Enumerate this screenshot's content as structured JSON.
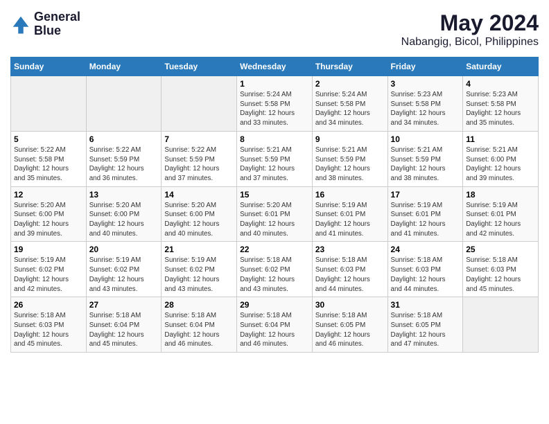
{
  "logo": {
    "line1": "General",
    "line2": "Blue"
  },
  "header": {
    "month": "May 2024",
    "location": "Nabangig, Bicol, Philippines"
  },
  "weekdays": [
    "Sunday",
    "Monday",
    "Tuesday",
    "Wednesday",
    "Thursday",
    "Friday",
    "Saturday"
  ],
  "weeks": [
    [
      {
        "day": "",
        "info": ""
      },
      {
        "day": "",
        "info": ""
      },
      {
        "day": "",
        "info": ""
      },
      {
        "day": "1",
        "info": "Sunrise: 5:24 AM\nSunset: 5:58 PM\nDaylight: 12 hours\nand 33 minutes."
      },
      {
        "day": "2",
        "info": "Sunrise: 5:24 AM\nSunset: 5:58 PM\nDaylight: 12 hours\nand 34 minutes."
      },
      {
        "day": "3",
        "info": "Sunrise: 5:23 AM\nSunset: 5:58 PM\nDaylight: 12 hours\nand 34 minutes."
      },
      {
        "day": "4",
        "info": "Sunrise: 5:23 AM\nSunset: 5:58 PM\nDaylight: 12 hours\nand 35 minutes."
      }
    ],
    [
      {
        "day": "5",
        "info": "Sunrise: 5:22 AM\nSunset: 5:58 PM\nDaylight: 12 hours\nand 35 minutes."
      },
      {
        "day": "6",
        "info": "Sunrise: 5:22 AM\nSunset: 5:59 PM\nDaylight: 12 hours\nand 36 minutes."
      },
      {
        "day": "7",
        "info": "Sunrise: 5:22 AM\nSunset: 5:59 PM\nDaylight: 12 hours\nand 37 minutes."
      },
      {
        "day": "8",
        "info": "Sunrise: 5:21 AM\nSunset: 5:59 PM\nDaylight: 12 hours\nand 37 minutes."
      },
      {
        "day": "9",
        "info": "Sunrise: 5:21 AM\nSunset: 5:59 PM\nDaylight: 12 hours\nand 38 minutes."
      },
      {
        "day": "10",
        "info": "Sunrise: 5:21 AM\nSunset: 5:59 PM\nDaylight: 12 hours\nand 38 minutes."
      },
      {
        "day": "11",
        "info": "Sunrise: 5:21 AM\nSunset: 6:00 PM\nDaylight: 12 hours\nand 39 minutes."
      }
    ],
    [
      {
        "day": "12",
        "info": "Sunrise: 5:20 AM\nSunset: 6:00 PM\nDaylight: 12 hours\nand 39 minutes."
      },
      {
        "day": "13",
        "info": "Sunrise: 5:20 AM\nSunset: 6:00 PM\nDaylight: 12 hours\nand 40 minutes."
      },
      {
        "day": "14",
        "info": "Sunrise: 5:20 AM\nSunset: 6:00 PM\nDaylight: 12 hours\nand 40 minutes."
      },
      {
        "day": "15",
        "info": "Sunrise: 5:20 AM\nSunset: 6:01 PM\nDaylight: 12 hours\nand 40 minutes."
      },
      {
        "day": "16",
        "info": "Sunrise: 5:19 AM\nSunset: 6:01 PM\nDaylight: 12 hours\nand 41 minutes."
      },
      {
        "day": "17",
        "info": "Sunrise: 5:19 AM\nSunset: 6:01 PM\nDaylight: 12 hours\nand 41 minutes."
      },
      {
        "day": "18",
        "info": "Sunrise: 5:19 AM\nSunset: 6:01 PM\nDaylight: 12 hours\nand 42 minutes."
      }
    ],
    [
      {
        "day": "19",
        "info": "Sunrise: 5:19 AM\nSunset: 6:02 PM\nDaylight: 12 hours\nand 42 minutes."
      },
      {
        "day": "20",
        "info": "Sunrise: 5:19 AM\nSunset: 6:02 PM\nDaylight: 12 hours\nand 43 minutes."
      },
      {
        "day": "21",
        "info": "Sunrise: 5:19 AM\nSunset: 6:02 PM\nDaylight: 12 hours\nand 43 minutes."
      },
      {
        "day": "22",
        "info": "Sunrise: 5:18 AM\nSunset: 6:02 PM\nDaylight: 12 hours\nand 43 minutes."
      },
      {
        "day": "23",
        "info": "Sunrise: 5:18 AM\nSunset: 6:03 PM\nDaylight: 12 hours\nand 44 minutes."
      },
      {
        "day": "24",
        "info": "Sunrise: 5:18 AM\nSunset: 6:03 PM\nDaylight: 12 hours\nand 44 minutes."
      },
      {
        "day": "25",
        "info": "Sunrise: 5:18 AM\nSunset: 6:03 PM\nDaylight: 12 hours\nand 45 minutes."
      }
    ],
    [
      {
        "day": "26",
        "info": "Sunrise: 5:18 AM\nSunset: 6:03 PM\nDaylight: 12 hours\nand 45 minutes."
      },
      {
        "day": "27",
        "info": "Sunrise: 5:18 AM\nSunset: 6:04 PM\nDaylight: 12 hours\nand 45 minutes."
      },
      {
        "day": "28",
        "info": "Sunrise: 5:18 AM\nSunset: 6:04 PM\nDaylight: 12 hours\nand 46 minutes."
      },
      {
        "day": "29",
        "info": "Sunrise: 5:18 AM\nSunset: 6:04 PM\nDaylight: 12 hours\nand 46 minutes."
      },
      {
        "day": "30",
        "info": "Sunrise: 5:18 AM\nSunset: 6:05 PM\nDaylight: 12 hours\nand 46 minutes."
      },
      {
        "day": "31",
        "info": "Sunrise: 5:18 AM\nSunset: 6:05 PM\nDaylight: 12 hours\nand 47 minutes."
      },
      {
        "day": "",
        "info": ""
      }
    ]
  ]
}
